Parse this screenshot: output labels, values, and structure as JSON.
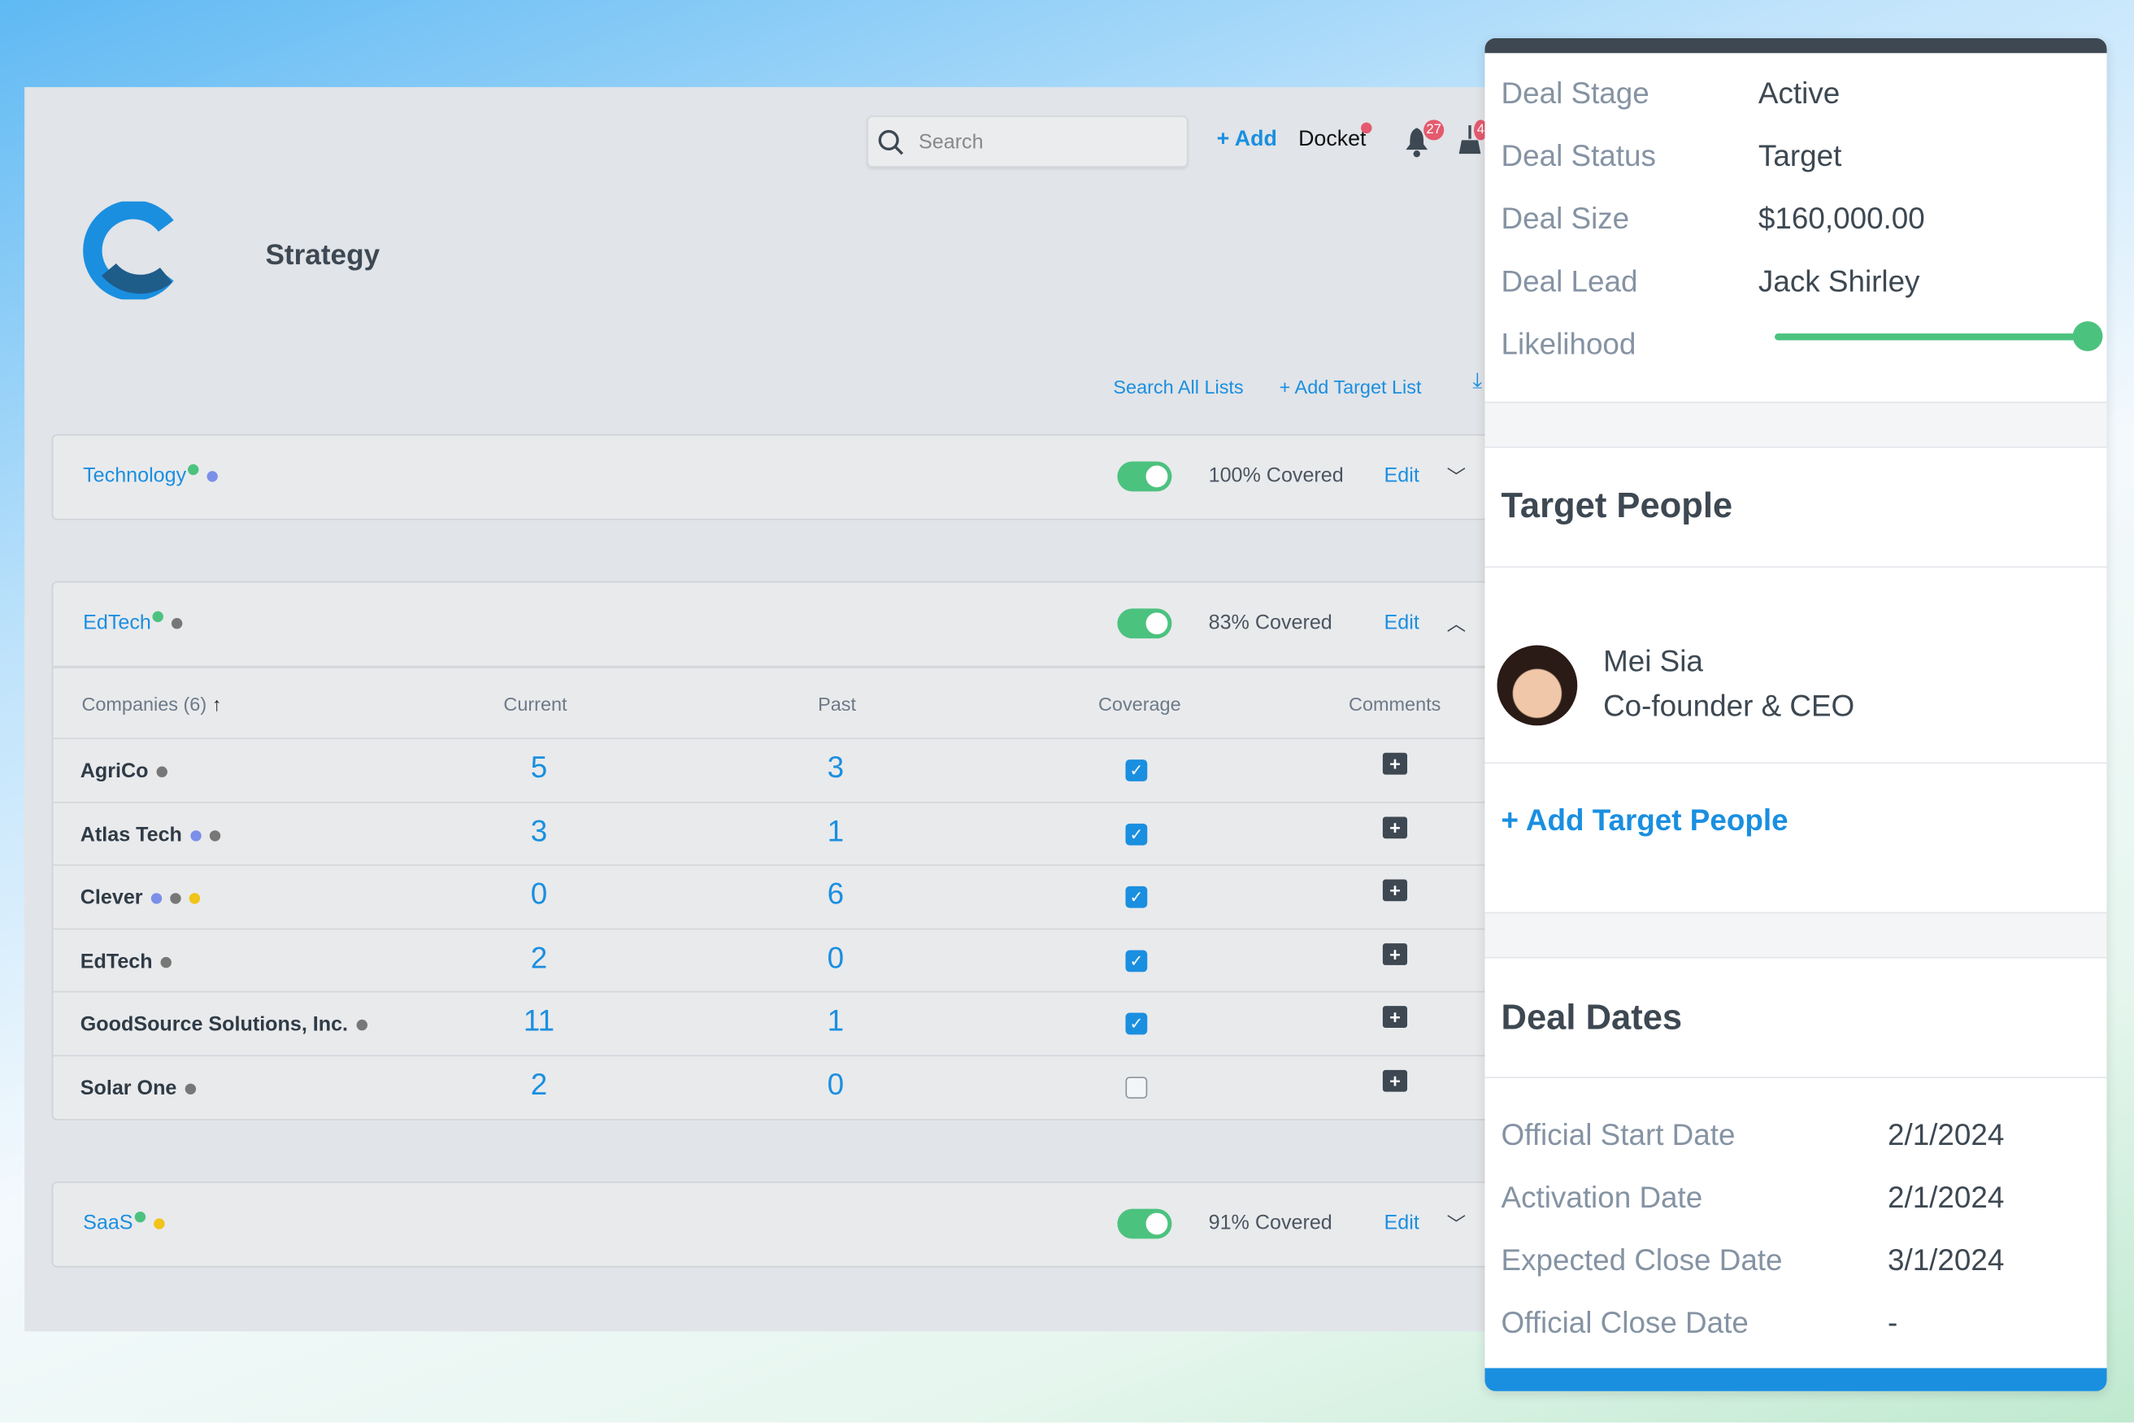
{
  "header": {
    "search_placeholder": "Search",
    "add_label": "+ Add",
    "docket_label": "Docket",
    "notifications_count": "27",
    "cleanup_count": "4"
  },
  "page": {
    "title": "Strategy",
    "search_all_lists": "Search All Lists",
    "add_target_list": "+ Add Target List"
  },
  "colors": {
    "accent": "#1a8fe0",
    "green": "#4cc27f",
    "blue_dot": "#7b8fe8",
    "gray_dot": "#777777",
    "yellow_dot": "#f0c419"
  },
  "lists": [
    {
      "name": "Technology",
      "enabled": true,
      "coverage": "100% Covered",
      "edit": "Edit",
      "expanded": false,
      "dots": [
        "blue"
      ]
    },
    {
      "name": "EdTech",
      "enabled": true,
      "coverage": "83% Covered",
      "edit": "Edit",
      "expanded": true,
      "dots": [
        "gray"
      ]
    },
    {
      "name": "SaaS",
      "enabled": true,
      "coverage": "91% Covered",
      "edit": "Edit",
      "expanded": false,
      "dots": [
        "yellow"
      ]
    }
  ],
  "table": {
    "headers": {
      "companies": "Companies (6)",
      "current": "Current",
      "past": "Past",
      "coverage": "Coverage",
      "comments": "Comments"
    },
    "rows": [
      {
        "name": "AgriCo",
        "current": "5",
        "past": "3",
        "covered": true,
        "dots": [
          "gray"
        ]
      },
      {
        "name": "Atlas Tech",
        "current": "3",
        "past": "1",
        "covered": true,
        "dots": [
          "blue",
          "gray"
        ]
      },
      {
        "name": "Clever",
        "current": "0",
        "past": "6",
        "covered": true,
        "dots": [
          "blue",
          "gray",
          "yellow"
        ]
      },
      {
        "name": "EdTech",
        "current": "2",
        "past": "0",
        "covered": true,
        "dots": [
          "gray"
        ]
      },
      {
        "name": "GoodSource Solutions, Inc.",
        "current": "11",
        "past": "1",
        "covered": true,
        "dots": [
          "gray"
        ]
      },
      {
        "name": "Solar One",
        "current": "2",
        "past": "0",
        "covered": false,
        "dots": [
          "gray"
        ]
      }
    ]
  },
  "deal": {
    "stage_label": "Deal Stage",
    "stage": "Active",
    "status_label": "Deal Status",
    "status": "Target",
    "size_label": "Deal Size",
    "size": "$160,000.00",
    "lead_label": "Deal Lead",
    "lead": "Jack Shirley",
    "likelihood_label": "Likelihood",
    "likelihood_percent": 100
  },
  "target_people": {
    "title": "Target People",
    "people": [
      {
        "name": "Mei Sia",
        "role": "Co-founder & CEO"
      }
    ],
    "add_label": "+ Add Target People"
  },
  "deal_dates": {
    "title": "Deal Dates",
    "items": [
      {
        "label": "Official Start Date",
        "value": "2/1/2024"
      },
      {
        "label": "Activation Date",
        "value": "2/1/2024"
      },
      {
        "label": "Expected Close Date",
        "value": "3/1/2024"
      },
      {
        "label": "Official Close Date",
        "value": "-"
      }
    ]
  }
}
